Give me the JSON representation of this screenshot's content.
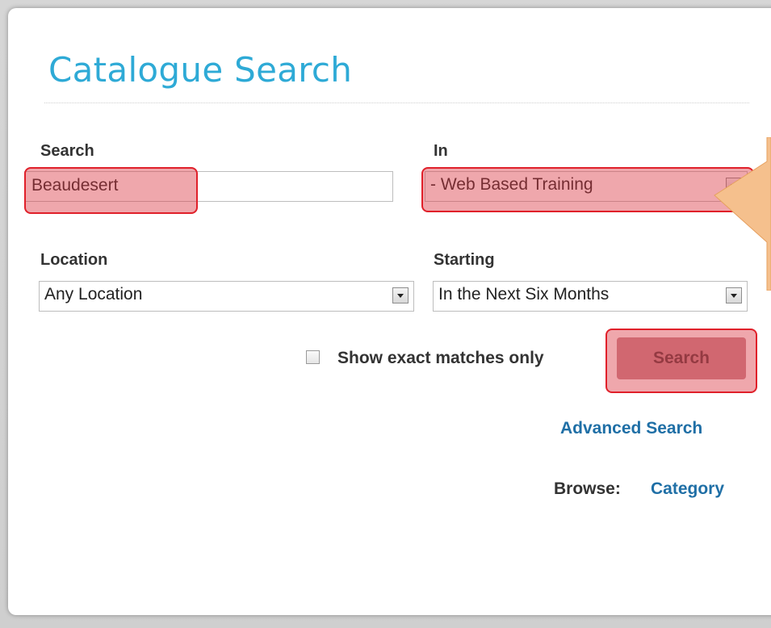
{
  "page": {
    "title": "Catalogue Search"
  },
  "search": {
    "label": "Search",
    "value": "Beaudesert"
  },
  "in": {
    "label": "In",
    "selected": "- Web Based Training"
  },
  "location": {
    "label": "Location",
    "selected": "Any Location"
  },
  "starting": {
    "label": "Starting",
    "selected": "In the Next Six Months"
  },
  "options": {
    "exact_label": "Show exact matches only",
    "exact_checked": false
  },
  "actions": {
    "search_button": "Search",
    "advanced_link": "Advanced Search",
    "browse_label": "Browse:",
    "category_link": "Category"
  },
  "colors": {
    "title": "#2eaad6",
    "link": "#1f6fa6",
    "highlight": "#e0202a",
    "callout": "#f5c08d"
  }
}
